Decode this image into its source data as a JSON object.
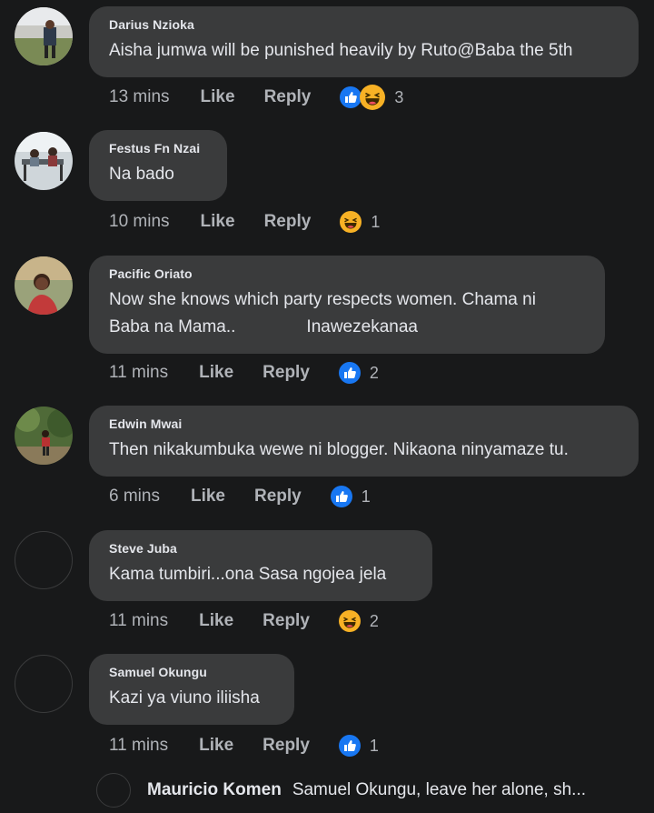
{
  "colors": {
    "background": "#18191a",
    "bubble": "#3a3b3c",
    "muted": "#b0b3b8",
    "like_blue": "#1877f2",
    "haha_yellow": "#f7b125"
  },
  "comments": [
    {
      "author": "Darius Nzioka",
      "text": "Aisha jumwa will be punished heavily by Ruto@Baba the 5th",
      "time": "13 mins",
      "like": "Like",
      "reply": "Reply",
      "reactions": [
        "like-icon",
        "haha-icon"
      ],
      "count": "3"
    },
    {
      "author": "Festus Fn Nzai",
      "text": "Na bado",
      "time": "10 mins",
      "like": "Like",
      "reply": "Reply",
      "reactions": [
        "haha-icon"
      ],
      "count": "1"
    },
    {
      "author": "Pacific Oriato",
      "text_line1": "Now she knows which party respects women. Chama ni",
      "text_line2a": "Baba na Mama..",
      "text_line2b": "Inawezekanaa",
      "time": "11 mins",
      "like": "Like",
      "reply": "Reply",
      "reactions": [
        "like-icon"
      ],
      "count": "2"
    },
    {
      "author": "Edwin Mwai",
      "text": "Then nikakumbuka wewe ni blogger. Nikaona ninyamaze tu.",
      "time": "6 mins",
      "like": "Like",
      "reply": "Reply",
      "reactions": [
        "like-icon"
      ],
      "count": "1"
    },
    {
      "author": "Steve Juba",
      "text": "Kama tumbiri...ona Sasa ngojea jela",
      "time": "11 mins",
      "like": "Like",
      "reply": "Reply",
      "reactions": [
        "haha-icon"
      ],
      "count": "2"
    },
    {
      "author": "Samuel Okungu",
      "text": "Kazi ya viuno iliisha",
      "time": "11 mins",
      "like": "Like",
      "reply": "Reply",
      "reactions": [
        "like-icon"
      ],
      "count": "1"
    }
  ],
  "reply_preview": {
    "author": "Mauricio Komen",
    "text": "Samuel Okungu, leave her alone, sh..."
  }
}
